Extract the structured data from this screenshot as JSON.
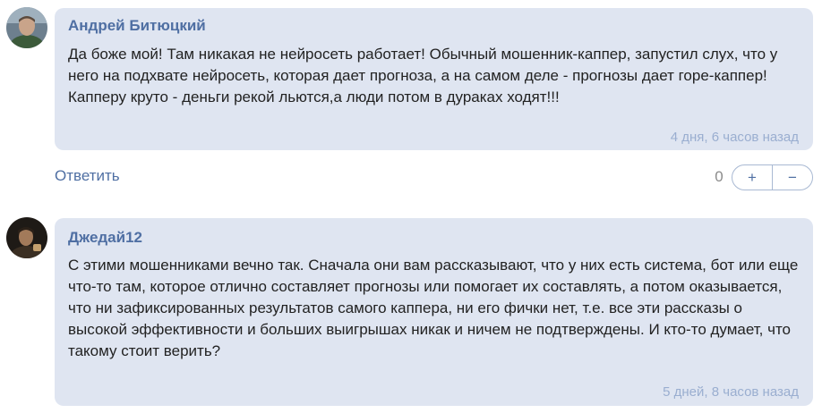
{
  "comments": [
    {
      "author": "Андрей Битюцкий",
      "text": "Да боже мой! Там никакая не нейросеть работает! Обычный мошенник-каппер, запустил слух, что у него на подхвате нейросеть, которая дает прогноза, а на самом деле - прогнозы дает горе-каппер! Капперу круто - деньги рекой льются,а люди потом в дураках ходят!!!",
      "time": "4 дня, 6 часов назад",
      "avatar_icon": "user-avatar-photo",
      "reply_label": "Ответить",
      "score": "0",
      "upvote_label": "+",
      "downvote_label": "−"
    },
    {
      "author": "Джедай12",
      "text": "С этими мошенниками вечно так. Сначала они вам рассказывают, что у них есть система, бот или еще что-то там, которое отлично составляет прогнозы или помогает их составлять, а потом оказывается, что ни зафиксированных результатов самого каппера, ни его фички нет, т.е. все эти рассказы о высокой эффективности и больших выигрышах никак и ничем не подтверждены. И кто-то думает, что такому стоит верить?",
      "time": "5 дней, 8 часов назад",
      "avatar_icon": "user-avatar-photo"
    }
  ],
  "colors": {
    "bubble_bg": "#dfe5f1",
    "author": "#4f6fa3",
    "timestamp": "#9aaed0",
    "link": "#4f6fa3"
  }
}
